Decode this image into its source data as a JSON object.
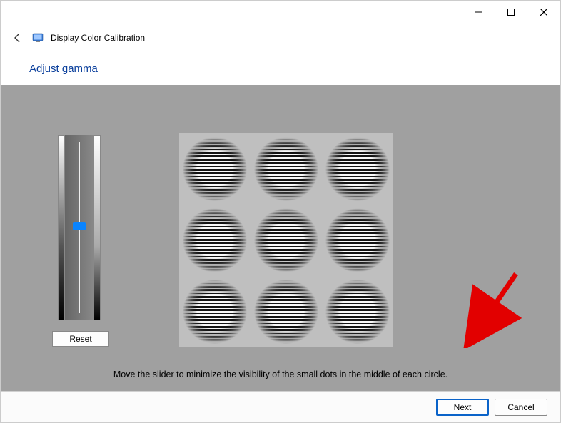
{
  "window": {
    "title": "Display Color Calibration"
  },
  "page": {
    "heading": "Adjust gamma",
    "instruction": "Move the slider to minimize the visibility of the small dots in the middle of each circle."
  },
  "controls": {
    "reset_label": "Reset",
    "next_label": "Next",
    "cancel_label": "Cancel"
  },
  "slider": {
    "value": 50
  }
}
